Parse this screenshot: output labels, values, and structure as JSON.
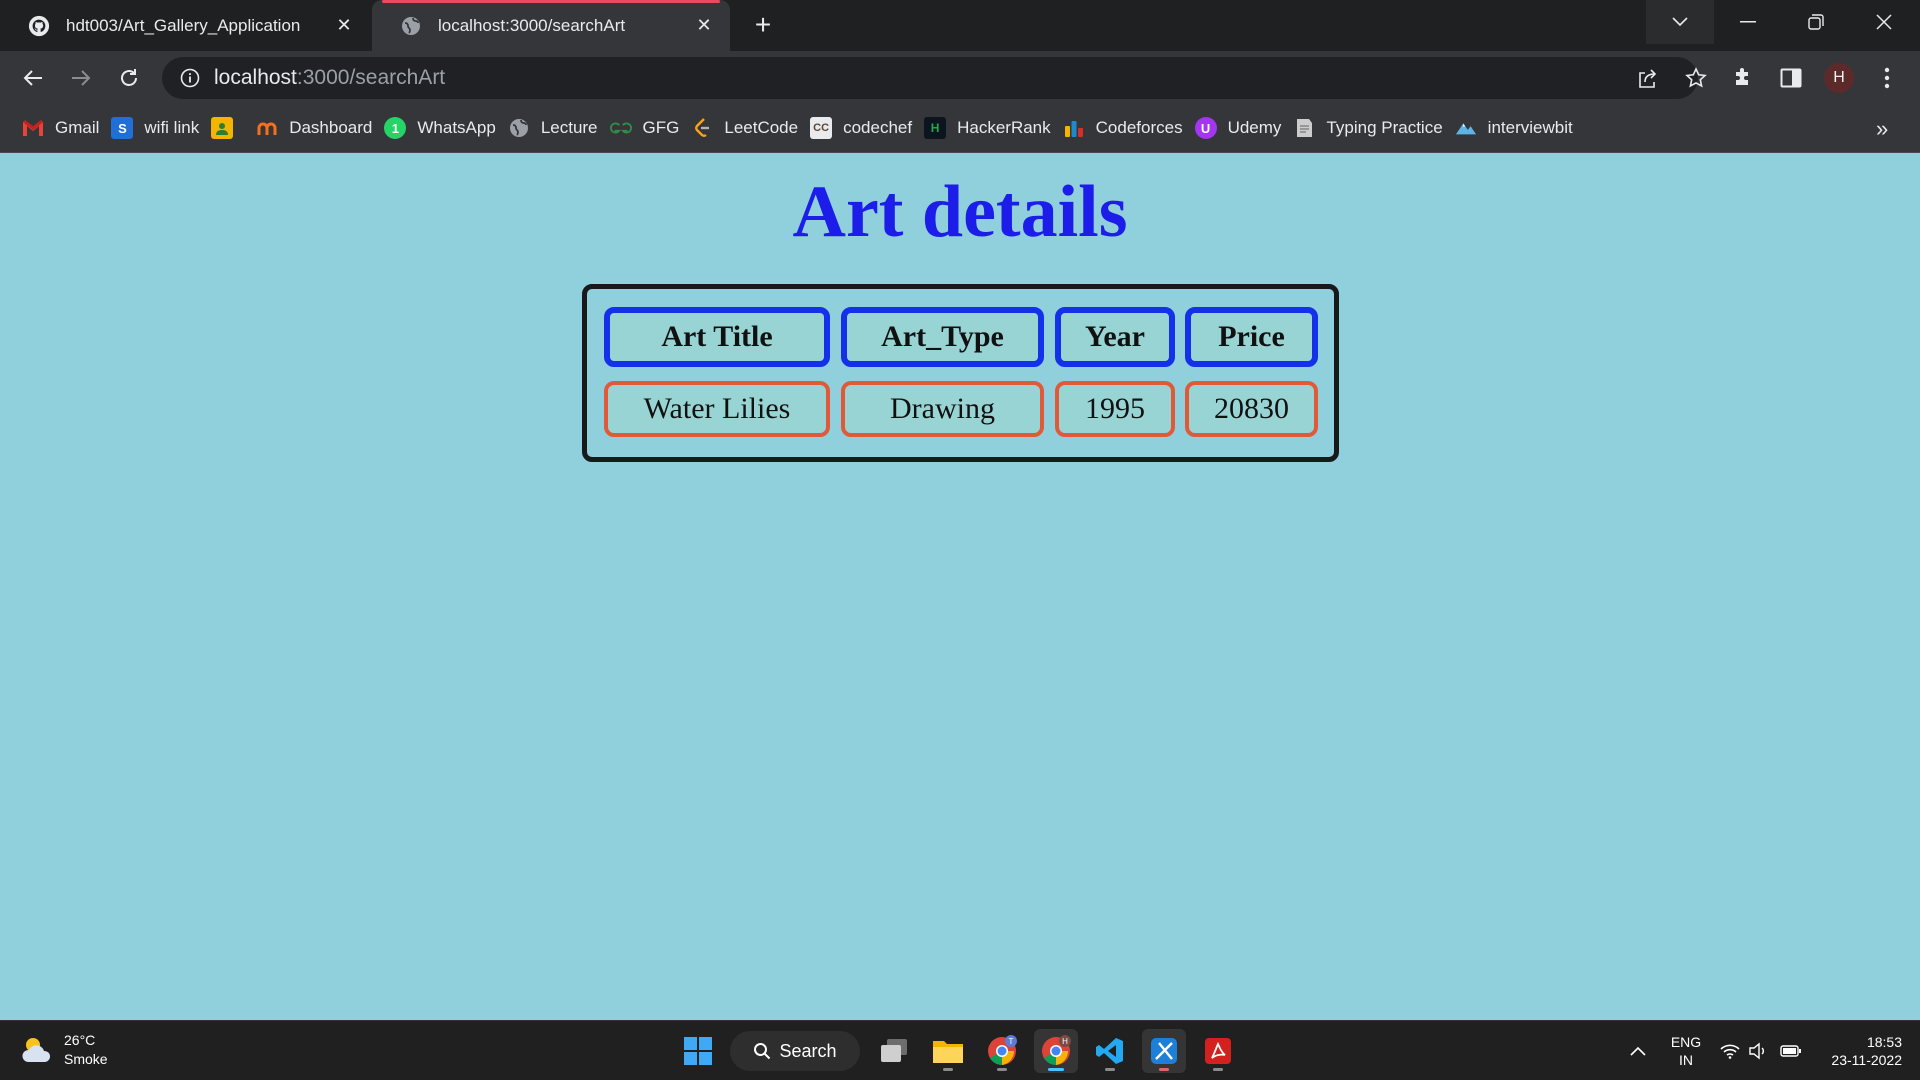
{
  "browser": {
    "tabs": [
      {
        "title": "hdt003/Art_Gallery_Application",
        "icon": "github-icon",
        "active": false
      },
      {
        "title": "localhost:3000/searchArt",
        "icon": "globe-icon",
        "active": true
      }
    ],
    "address_bar": {
      "host": "localhost",
      "path": ":3000/searchArt"
    },
    "profile_initial": "H",
    "bookmarks": [
      {
        "label": "Gmail",
        "icon": "gmail-icon",
        "color": "#ea4335"
      },
      {
        "label": "wifi link",
        "icon": "s-icon",
        "color": "#1f6fd6"
      },
      {
        "label": "",
        "icon": "contact-icon",
        "color": "#f4b400"
      },
      {
        "label": "Dashboard",
        "icon": "dashboard-icon",
        "color": "#f37021"
      },
      {
        "label": "WhatsApp",
        "icon": "whatsapp-icon",
        "color": "#25d366"
      },
      {
        "label": "Lecture",
        "icon": "globe-icon",
        "color": "#9aa0a6"
      },
      {
        "label": "GFG",
        "icon": "gfg-icon",
        "color": "#2f8d46"
      },
      {
        "label": "LeetCode",
        "icon": "leetcode-icon",
        "color": "#ffa116"
      },
      {
        "label": "codechef",
        "icon": "codechef-icon",
        "color": "#5b4638"
      },
      {
        "label": "HackerRank",
        "icon": "hackerrank-icon",
        "color": "#1ba94c"
      },
      {
        "label": "Codeforces",
        "icon": "codeforces-icon",
        "color": "#1f8acb"
      },
      {
        "label": "Udemy",
        "icon": "udemy-icon",
        "color": "#a435f0"
      },
      {
        "label": "Typing Practice",
        "icon": "typing-icon",
        "color": "#cccccc"
      },
      {
        "label": "interviewbit",
        "icon": "interviewbit-icon",
        "color": "#5fb4e6"
      }
    ],
    "bookmarks_more": "»"
  },
  "page": {
    "heading": "Art details",
    "table": {
      "headers": [
        "Art Title",
        "Art_Type",
        "Year",
        "Price"
      ],
      "rows": [
        [
          "Water Lilies",
          "Drawing",
          "1995",
          "20830"
        ]
      ]
    }
  },
  "taskbar": {
    "weather": {
      "temp": "26°C",
      "condition": "Smoke"
    },
    "search_label": "Search",
    "language": {
      "line1": "ENG",
      "line2": "IN"
    },
    "clock": {
      "time": "18:53",
      "date": "23-11-2022"
    }
  },
  "colors": {
    "page_bg": "#8fd0dc",
    "heading": "#1d1dea",
    "header_border": "#1430e8",
    "cell_border": "#e05a3a",
    "tab_accent": "#e94a5c"
  }
}
